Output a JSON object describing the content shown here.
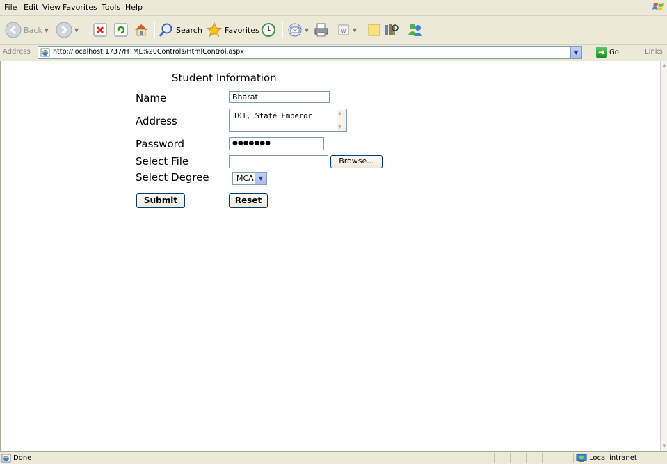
{
  "menu": [
    "File",
    "Edit",
    "View",
    "Favorites",
    "Tools",
    "Help"
  ],
  "toolbar": {
    "back_label": "Back",
    "search_label": "Search",
    "favorites_label": "Favorites"
  },
  "address": {
    "label": "Address",
    "url": "http://localhost:1737/HTML%20Controls/HtmlControl.aspx",
    "go_label": "Go",
    "links_label": "Links"
  },
  "form": {
    "title": "Student Information",
    "name_label": "Name",
    "name_value": "Bharat",
    "address_label": "Address",
    "address_value": "101, State Emperor",
    "password_label": "Password",
    "password_mask": "●●●●●●●",
    "file_label": "Select File",
    "file_value": "",
    "browse_label": "Browse...",
    "degree_label": "Select Degree",
    "degree_value": "MCA",
    "submit_label": "Submit",
    "reset_label": "Reset"
  },
  "status": {
    "text": "Done",
    "zone": "Local intranet"
  }
}
